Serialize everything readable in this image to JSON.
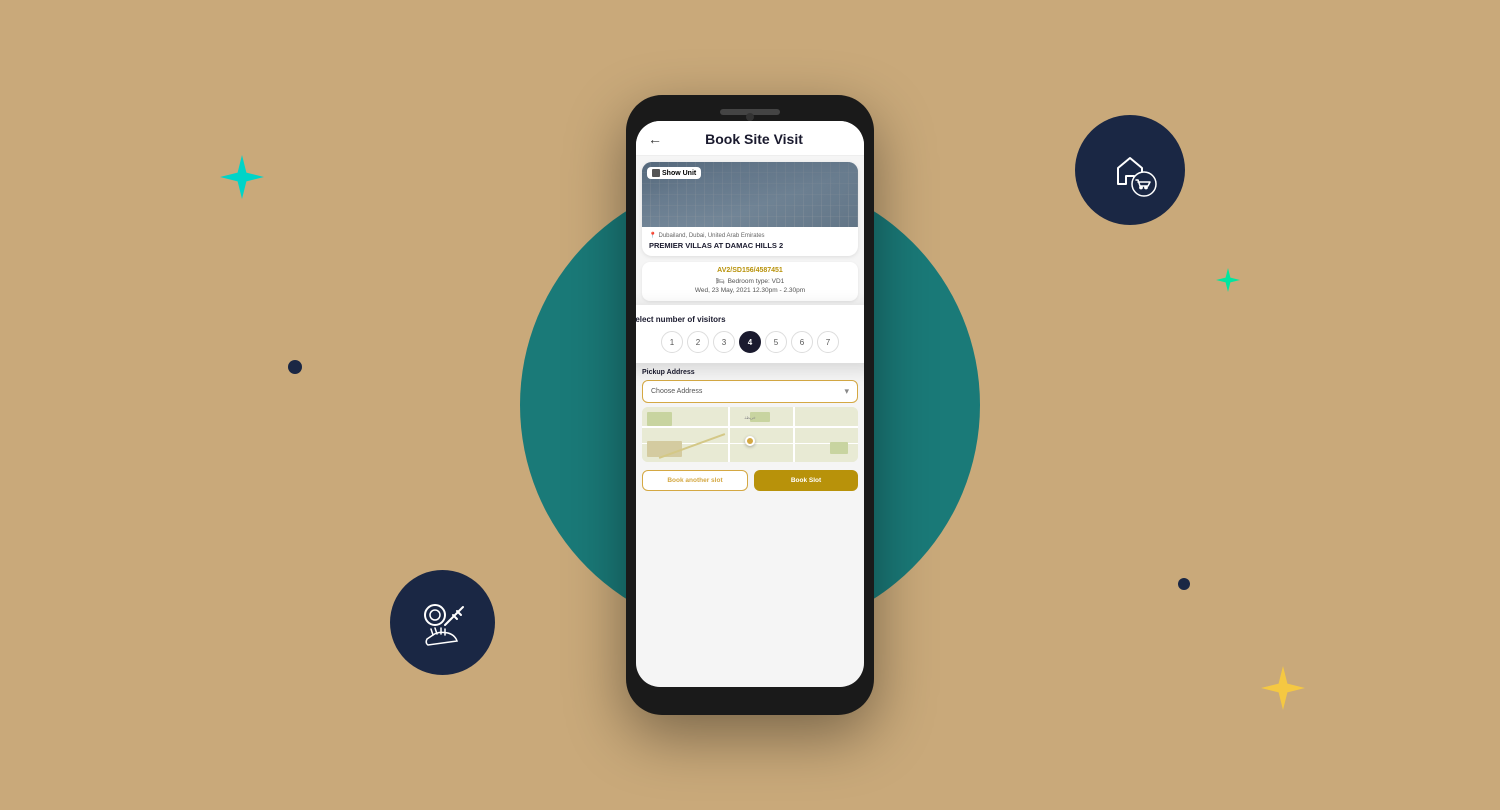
{
  "background": {
    "color": "#c9a97a"
  },
  "decorations": {
    "teal_circle_color": "#1a7a78",
    "star_cyan_color": "#00d4c8",
    "star_green_color": "#00e6a0",
    "star_yellow_color": "#f5c842",
    "dot_dark_color": "#1a2744",
    "icon_circle_bg": "#1a2744"
  },
  "app": {
    "back_label": "←",
    "title": "Book Site Visit",
    "property": {
      "badge": "Show Unit",
      "location": "Dubailand, Dubai, United Arab Emirates",
      "name": "PREMIER VILLAS AT DAMAC HILLS 2",
      "booking_id": "AV2/SD156/4587451",
      "bedroom_type": "Bedroom type: VD1",
      "date_time": "Wed, 23 May, 2021   12.30pm - 2.30pm"
    },
    "visitors": {
      "label": "Select number of visitors",
      "options": [
        "1",
        "2",
        "3",
        "4",
        "5",
        "6",
        "7"
      ],
      "selected": 3
    },
    "pickup": {
      "label": "Pickup Address",
      "dropdown_placeholder": "Choose Address",
      "dropdown_chevron": "▾"
    },
    "buttons": {
      "secondary": "Book another slot",
      "primary": "Book Slot"
    }
  }
}
